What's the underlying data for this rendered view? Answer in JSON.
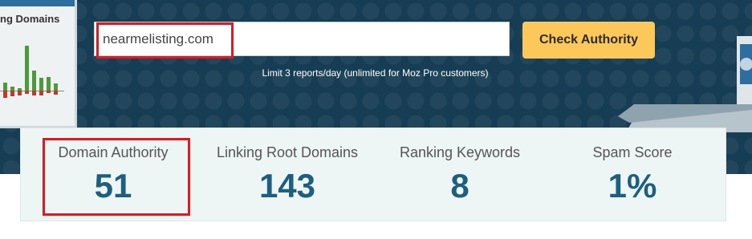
{
  "side_panel": {
    "title": "ng Domains"
  },
  "search": {
    "value": "nearmelisting.com",
    "button_label": "Check Authority",
    "limit_note": "Limit 3 reports/day (unlimited for Moz Pro customers)"
  },
  "stats": [
    {
      "label": "Domain Authority",
      "value": "51"
    },
    {
      "label": "Linking Root Domains",
      "value": "143"
    },
    {
      "label": "Ranking Keywords",
      "value": "8"
    },
    {
      "label": "Spam Score",
      "value": "1%"
    }
  ],
  "colors": {
    "hero_bg": "#163d54",
    "button_bg": "#fcc85a",
    "stat_value": "#1e5f80",
    "highlight": "#e0181f"
  }
}
